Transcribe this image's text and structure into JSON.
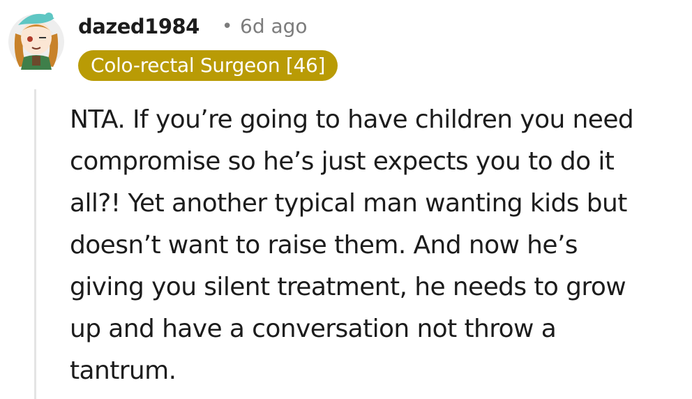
{
  "comment": {
    "username": "dazed1984",
    "separator": "•",
    "timestamp": "6d ago",
    "flair": "Colo-rectal Surgeon [46]",
    "body_lines": [
      "NTA. If you’re going to have children you need",
      "compromise so he’s just expects you to do it",
      "all?! Yet another typical man wanting kids but",
      "doesn’t want to raise them. And now he’s",
      "giving you silent treatment, he needs to grow",
      "up and have a conversation not throw a",
      "tantrum."
    ]
  },
  "colors": {
    "flair_background": "#b99b05",
    "flair_text": "#ffffff",
    "meta_text": "#7c7c7c",
    "thread_line": "#e4e4e4"
  },
  "icons": {
    "avatar": "user-avatar-icon"
  }
}
